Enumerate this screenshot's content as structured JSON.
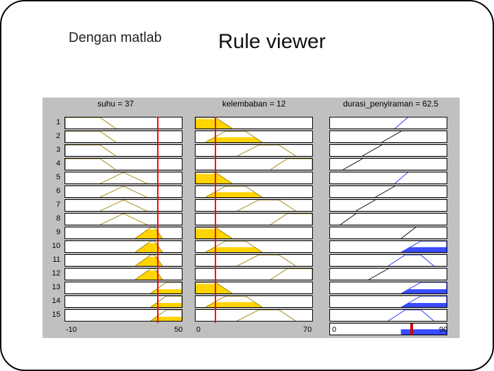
{
  "slide": {
    "subtitle": "Dengan matlab",
    "title": "Rule viewer"
  },
  "chart_data": {
    "type": "table",
    "inputs": [
      {
        "name": "suhu",
        "value": 37,
        "range": [
          -10,
          50
        ]
      },
      {
        "name": "kelembaban",
        "value": 12,
        "range": [
          0,
          70
        ]
      }
    ],
    "output": {
      "name": "durasi_penyiraman",
      "value": 62.5,
      "range": [
        0,
        90
      ]
    },
    "columns": [
      {
        "label": "suhu = 37",
        "min": -10,
        "max": 50,
        "value": 37
      },
      {
        "label": "kelembaban = 12",
        "min": 0,
        "max": 70,
        "value": 12
      },
      {
        "label": "durasi_penyiraman = 62.5",
        "min": 0,
        "max": 90,
        "value": 62.5
      }
    ],
    "rules": [
      {
        "n": 1,
        "suhu": {
          "mf": "trap",
          "a": -10,
          "b": -10,
          "c": 8,
          "d": 16,
          "fill": 0.0
        },
        "kelembaban": {
          "mf": "trap",
          "a": 0,
          "b": 0,
          "c": 12,
          "d": 22,
          "fill": 0.86
        },
        "durasi": {
          "mf": "line",
          "a": 50,
          "b": 60,
          "fill": 0.0,
          "color": "blue"
        }
      },
      {
        "n": 2,
        "suhu": {
          "mf": "trap",
          "a": -10,
          "b": -10,
          "c": 8,
          "d": 16,
          "fill": 0.0
        },
        "kelembaban": {
          "mf": "trap",
          "a": 6,
          "b": 18,
          "c": 30,
          "d": 40,
          "fill": 0.45
        },
        "durasi": {
          "mf": "line",
          "a": 40,
          "b": 55,
          "fill": 0.0,
          "color": "black"
        }
      },
      {
        "n": 3,
        "suhu": {
          "mf": "trap",
          "a": -10,
          "b": -10,
          "c": 8,
          "d": 16,
          "fill": 0.0
        },
        "kelembaban": {
          "mf": "trap",
          "a": 25,
          "b": 38,
          "c": 50,
          "d": 60,
          "fill": 0.0
        },
        "durasi": {
          "mf": "line",
          "a": 25,
          "b": 40,
          "fill": 0.0,
          "color": "black"
        }
      },
      {
        "n": 4,
        "suhu": {
          "mf": "trap",
          "a": -10,
          "b": -10,
          "c": 8,
          "d": 16,
          "fill": 0.0
        },
        "kelembaban": {
          "mf": "trap",
          "a": 45,
          "b": 55,
          "c": 70,
          "d": 70,
          "fill": 0.0
        },
        "durasi": {
          "mf": "line",
          "a": 10,
          "b": 25,
          "fill": 0.0,
          "color": "black"
        }
      },
      {
        "n": 5,
        "suhu": {
          "mf": "tri",
          "a": 8,
          "b": 20,
          "c": 32,
          "fill": 0.0
        },
        "kelembaban": {
          "mf": "trap",
          "a": 0,
          "b": 0,
          "c": 12,
          "d": 22,
          "fill": 0.86
        },
        "durasi": {
          "mf": "line",
          "a": 50,
          "b": 60,
          "fill": 0.0,
          "color": "blue"
        }
      },
      {
        "n": 6,
        "suhu": {
          "mf": "tri",
          "a": 8,
          "b": 20,
          "c": 32,
          "fill": 0.0
        },
        "kelembaban": {
          "mf": "trap",
          "a": 6,
          "b": 18,
          "c": 30,
          "d": 40,
          "fill": 0.45
        },
        "durasi": {
          "mf": "line",
          "a": 35,
          "b": 50,
          "fill": 0.0,
          "color": "black"
        }
      },
      {
        "n": 7,
        "suhu": {
          "mf": "tri",
          "a": 8,
          "b": 20,
          "c": 32,
          "fill": 0.0
        },
        "kelembaban": {
          "mf": "trap",
          "a": 25,
          "b": 38,
          "c": 50,
          "d": 60,
          "fill": 0.0
        },
        "durasi": {
          "mf": "line",
          "a": 20,
          "b": 35,
          "fill": 0.0,
          "color": "black"
        }
      },
      {
        "n": 8,
        "suhu": {
          "mf": "tri",
          "a": 8,
          "b": 20,
          "c": 32,
          "fill": 0.0
        },
        "kelembaban": {
          "mf": "trap",
          "a": 45,
          "b": 55,
          "c": 70,
          "d": 70,
          "fill": 0.0
        },
        "durasi": {
          "mf": "line",
          "a": 8,
          "b": 20,
          "fill": 0.0,
          "color": "black"
        }
      },
      {
        "n": 9,
        "suhu": {
          "mf": "trap",
          "a": 26,
          "b": 34,
          "c": 36,
          "d": 40,
          "fill": 0.82
        },
        "kelembaban": {
          "mf": "trap",
          "a": 0,
          "b": 0,
          "c": 12,
          "d": 22,
          "fill": 0.86
        },
        "durasi": {
          "mf": "line",
          "a": 55,
          "b": 66,
          "fill": 0.0,
          "color": "black"
        }
      },
      {
        "n": 10,
        "suhu": {
          "mf": "trap",
          "a": 26,
          "b": 34,
          "c": 36,
          "d": 40,
          "fill": 0.82
        },
        "kelembaban": {
          "mf": "trap",
          "a": 6,
          "b": 18,
          "c": 30,
          "d": 40,
          "fill": 0.45
        },
        "durasi": {
          "mf": "trap",
          "a": 55,
          "b": 70,
          "c": 90,
          "d": 90,
          "fill": 0.45,
          "color": "blue"
        }
      },
      {
        "n": 11,
        "suhu": {
          "mf": "trap",
          "a": 26,
          "b": 34,
          "c": 36,
          "d": 40,
          "fill": 0.82
        },
        "kelembaban": {
          "mf": "trap",
          "a": 25,
          "b": 38,
          "c": 50,
          "d": 60,
          "fill": 0.0
        },
        "durasi": {
          "mf": "trap",
          "a": 45,
          "b": 58,
          "c": 70,
          "d": 80,
          "fill": 0.0,
          "color": "blue"
        }
      },
      {
        "n": 12,
        "suhu": {
          "mf": "trap",
          "a": 26,
          "b": 34,
          "c": 36,
          "d": 40,
          "fill": 0.82
        },
        "kelembaban": {
          "mf": "trap",
          "a": 45,
          "b": 55,
          "c": 70,
          "d": 70,
          "fill": 0.0
        },
        "durasi": {
          "mf": "line",
          "a": 30,
          "b": 45,
          "fill": 0.0,
          "color": "black"
        }
      },
      {
        "n": 13,
        "suhu": {
          "mf": "trap",
          "a": 34,
          "b": 42,
          "c": 50,
          "d": 50,
          "fill": 0.38
        },
        "kelembaban": {
          "mf": "trap",
          "a": 0,
          "b": 0,
          "c": 12,
          "d": 22,
          "fill": 0.86
        },
        "durasi": {
          "mf": "trap",
          "a": 55,
          "b": 70,
          "c": 90,
          "d": 90,
          "fill": 0.38,
          "color": "blue"
        }
      },
      {
        "n": 14,
        "suhu": {
          "mf": "trap",
          "a": 34,
          "b": 42,
          "c": 50,
          "d": 50,
          "fill": 0.38
        },
        "kelembaban": {
          "mf": "trap",
          "a": 6,
          "b": 18,
          "c": 30,
          "d": 40,
          "fill": 0.45
        },
        "durasi": {
          "mf": "trap",
          "a": 55,
          "b": 70,
          "c": 90,
          "d": 90,
          "fill": 0.38,
          "color": "blue"
        }
      },
      {
        "n": 15,
        "suhu": {
          "mf": "trap",
          "a": 34,
          "b": 42,
          "c": 50,
          "d": 50,
          "fill": 0.38
        },
        "kelembaban": {
          "mf": "trap",
          "a": 25,
          "b": 38,
          "c": 50,
          "d": 60,
          "fill": 0.0
        },
        "durasi": {
          "mf": "trap",
          "a": 45,
          "b": 58,
          "c": 70,
          "d": 80,
          "fill": 0.0,
          "color": "blue"
        }
      }
    ],
    "aggregate": {
      "fill_regions": [
        [
          55,
          90,
          0.45
        ]
      ]
    },
    "ticks": [
      {
        "col": 0,
        "labels": [
          {
            "v": -10,
            "t": "-10"
          },
          {
            "v": 50,
            "t": "50"
          }
        ]
      },
      {
        "col": 1,
        "labels": [
          {
            "v": 0,
            "t": "0"
          },
          {
            "v": 70,
            "t": "70"
          }
        ]
      },
      {
        "col": 2,
        "labels": [
          {
            "v": 0,
            "t": "0"
          },
          {
            "v": 90,
            "t": "90"
          }
        ]
      }
    ]
  }
}
